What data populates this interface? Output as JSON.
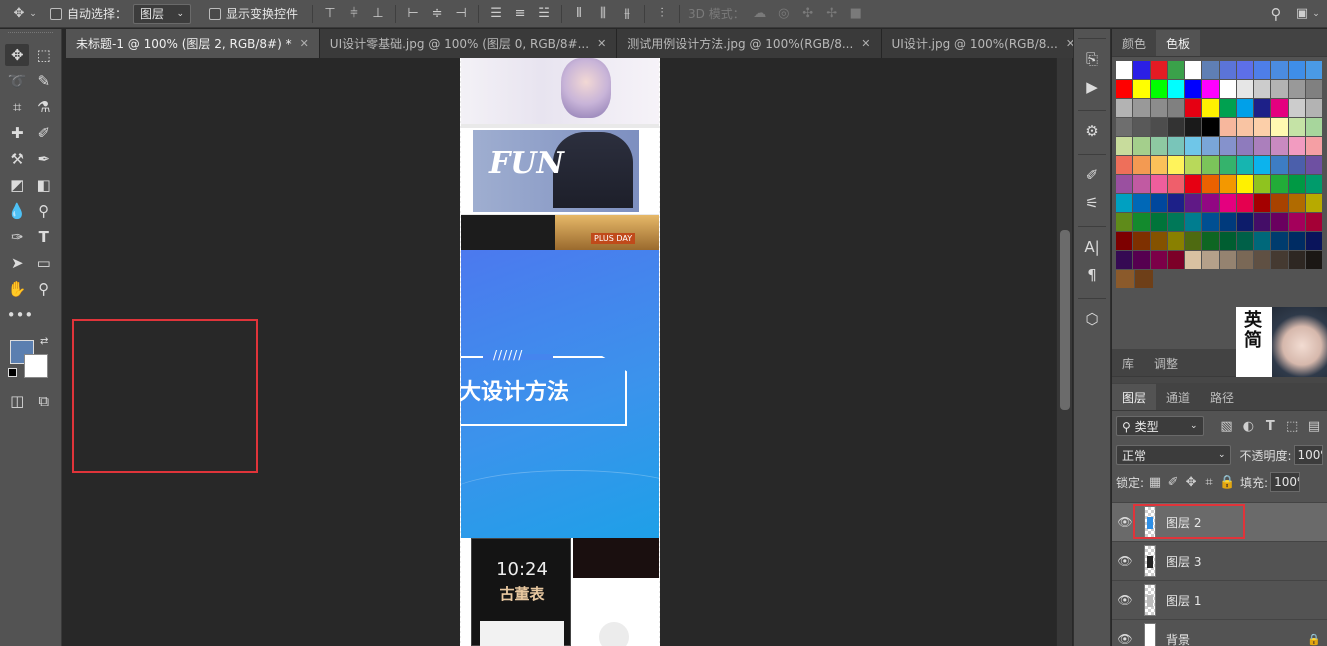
{
  "options_bar": {
    "auto_select_label": "自动选择：",
    "auto_select_value": "图层",
    "show_transform_label": "显示变换控件",
    "mode_3d_label": "3D 模式："
  },
  "tabs": [
    {
      "label": "未标题-1 @ 100% (图层 2, RGB/8#) *",
      "active": true
    },
    {
      "label": "UI设计零基础.jpg @ 100% (图层 0, RGB/8#...",
      "active": false
    },
    {
      "label": "测试用例设计方法.jpg @ 100%(RGB/8...",
      "active": false
    },
    {
      "label": "UI设计.jpg @ 100%(RGB/8...",
      "active": false
    }
  ],
  "canvas": {
    "fun_text": "FUN",
    "plus_day_text": "PLUS DAY",
    "banner_slashes": "//////",
    "banner_title": "大设计方法",
    "phone_time": "10:24",
    "phone_brand": "古董表"
  },
  "colors": {
    "foreground": "#5b7fb0",
    "background": "#ffffff",
    "selection": "#e0343a"
  },
  "color_panel": {
    "tabs": [
      {
        "label": "颜色",
        "active": false
      },
      {
        "label": "色板",
        "active": true
      }
    ],
    "swatch_rows": [
      [
        "#ffffff",
        "#2b1fe6",
        "#e31b23",
        "#3aa14a",
        "#ffffff",
        "#5f7fb4",
        "#5b74d8",
        "#5d6fe8",
        "#4e7ee8",
        "#4b8ce0",
        "#3f8ee8",
        "#4a9ae6"
      ],
      [
        "#ff0000",
        "#ffff00",
        "#00ff00",
        "#00ffff",
        "#0000ff",
        "#ff00ff",
        "#ffffff",
        "#e6e6e6",
        "#cccccc",
        "#b3b3b3",
        "#999999",
        "#808080"
      ],
      [
        "#b3b3b3",
        "#999999",
        "#8c8c8c",
        "#808080",
        "#e60012",
        "#fff100",
        "#00a150",
        "#00a0e9",
        "#1d2088",
        "#e4007f",
        "#cccccc",
        "#b3b3b3"
      ],
      [
        "#6e6e6e",
        "#595959",
        "#4d4d4d",
        "#333333",
        "#1a1a1a",
        "#000000",
        "#f7b79d",
        "#f9c4a3",
        "#fccfa9",
        "#fff9b1",
        "#c5e3a6",
        "#a7d69c"
      ],
      [
        "#c8dc9c",
        "#a4cf8c",
        "#8ec9a2",
        "#79c5b9",
        "#6fc6e8",
        "#7aa6d8",
        "#8592cc",
        "#8e7bbd",
        "#ab7fbc",
        "#c98ac0",
        "#f29bc0",
        "#f59fa4"
      ],
      [
        "#ee6f5a",
        "#f39a52",
        "#fbc159",
        "#fff35b",
        "#b8d95a",
        "#7bc45a",
        "#35b36c",
        "#16b5b0",
        "#0cb3ed",
        "#3d7dc4",
        "#4b5fab",
        "#6e50a2"
      ],
      [
        "#9a50a0",
        "#c15aa2",
        "#ef5e9c",
        "#ef5f6b",
        "#e60012",
        "#eb6100",
        "#f39800",
        "#fff100",
        "#8fc31f",
        "#22ac38",
        "#009944",
        "#009b6b"
      ],
      [
        "#00a0c1",
        "#0068b7",
        "#00479d",
        "#1d2088",
        "#601986",
        "#920783",
        "#e4007f",
        "#e5004f",
        "#a40000",
        "#a84200",
        "#b16b00",
        "#b7aa00"
      ],
      [
        "#5f8b1a",
        "#138a2d",
        "#00743a",
        "#007858",
        "#007d8f",
        "#004f92",
        "#003a7c",
        "#0d1c6a",
        "#440d67",
        "#6a005f",
        "#a4005b",
        "#a40036"
      ],
      [
        "#7d0000",
        "#7e3000",
        "#845200",
        "#898000",
        "#4e6a11",
        "#0e6623",
        "#005e31",
        "#006048",
        "#00687a",
        "#003c6e",
        "#002c63",
        "#0a145b"
      ],
      [
        "#350a53",
        "#560050",
        "#7c0048",
        "#7c0028",
        "#d9c1a1",
        "#b4a08a",
        "#958370",
        "#7a6856",
        "#5f5043",
        "#453a31",
        "#2e2722",
        "#1b1714"
      ],
      [
        "#8b5a2b",
        "#6e3f18"
      ]
    ],
    "ad_text": "英简"
  },
  "layers_panel": {
    "top_tabs": [
      {
        "label": "库",
        "active": false
      },
      {
        "label": "调整",
        "active": false
      }
    ],
    "tabs": [
      {
        "label": "图层",
        "active": true
      },
      {
        "label": "通道",
        "active": false
      },
      {
        "label": "路径",
        "active": false
      }
    ],
    "filter_label": "类型",
    "blend_mode": "正常",
    "opacity_label": "不透明度:",
    "opacity_value": "100%",
    "lock_label": "锁定:",
    "fill_label": "填充:",
    "fill_value": "100%",
    "layers": [
      {
        "name": "图层 2",
        "active": true,
        "locked": false
      },
      {
        "name": "图层 3",
        "active": false,
        "locked": false
      },
      {
        "name": "图层 1",
        "active": false,
        "locked": false
      },
      {
        "name": "背景",
        "active": false,
        "locked": true
      }
    ]
  }
}
